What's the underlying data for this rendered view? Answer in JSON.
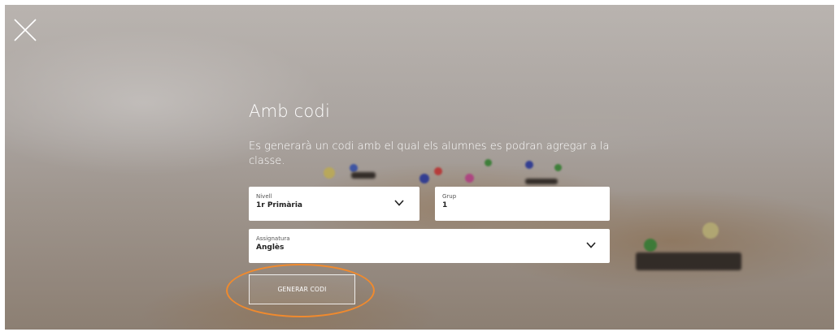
{
  "dialog": {
    "title": "Amb codi",
    "description": "Es generarà un codi amb el qual els alumnes es podran agregar a la classe."
  },
  "form": {
    "nivell": {
      "label": "Nivell",
      "value": "1r Primària"
    },
    "grup": {
      "label": "Grup",
      "value": "1"
    },
    "assignatura": {
      "label": "Assignatura",
      "value": "Anglès"
    },
    "generate_label": "GENERAR CODI"
  },
  "colors": {
    "highlight": "#f08a2e",
    "text": "#ffffff"
  },
  "icons": {
    "close": "close-icon",
    "dropdown": "chevron-down-icon"
  }
}
